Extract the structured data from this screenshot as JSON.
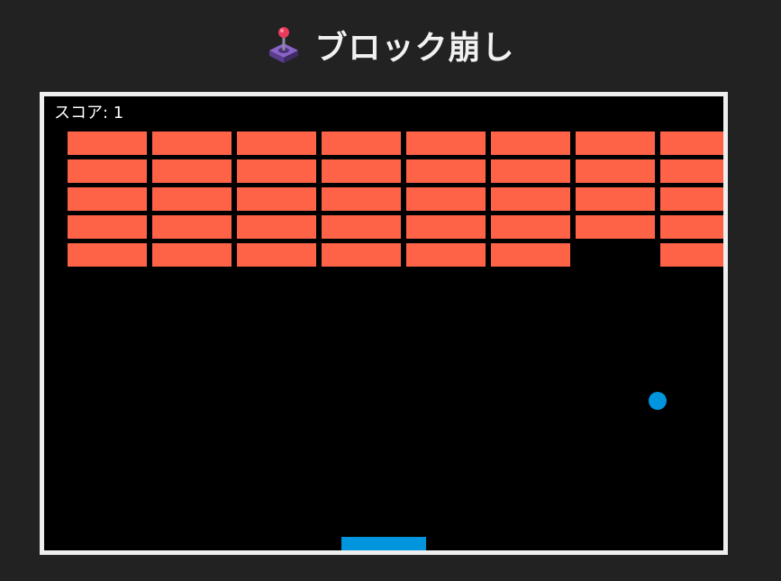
{
  "page": {
    "title": "ブロック崩し",
    "title_icon": "joystick-icon"
  },
  "game": {
    "score_label": "スコア: 1",
    "score": 1,
    "colors": {
      "page_background": "#222222",
      "canvas_background": "#000000",
      "canvas_border": "#eeeeee",
      "brick": "#ff6347",
      "ball": "#0095dd",
      "paddle": "#0095dd",
      "title_text": "#f1f1f1",
      "score_text": "#ffffff"
    },
    "brick_grid": {
      "columns_visible": 8,
      "rows": 5,
      "bricks_remaining": [
        [
          1,
          1,
          1,
          1,
          1,
          1,
          1,
          1
        ],
        [
          1,
          1,
          1,
          1,
          1,
          1,
          1,
          1
        ],
        [
          1,
          1,
          1,
          1,
          1,
          1,
          1,
          1
        ],
        [
          1,
          1,
          1,
          1,
          1,
          1,
          1,
          1
        ],
        [
          1,
          1,
          1,
          1,
          1,
          1,
          0,
          1
        ]
      ]
    }
  }
}
